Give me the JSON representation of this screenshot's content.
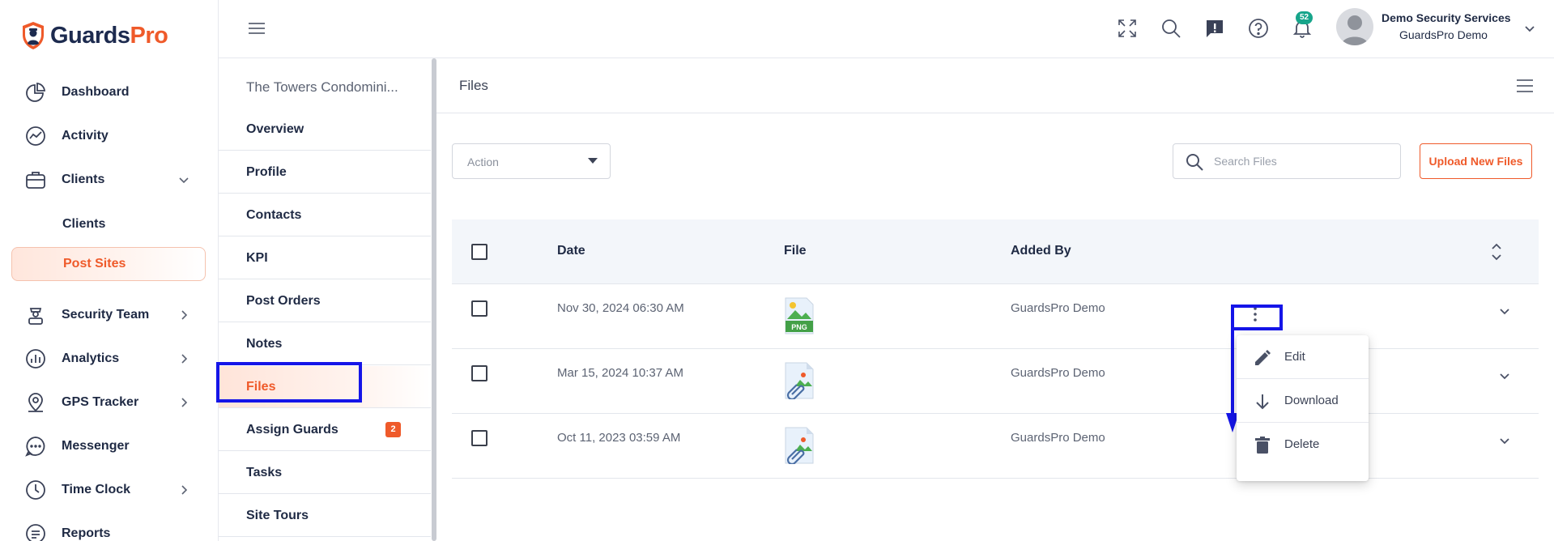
{
  "brand": {
    "name_part1": "Guards",
    "name_part2": "Pro",
    "color_primary": "#1d2b4f",
    "color_accent": "#ef5a2a"
  },
  "sidebar": {
    "items": [
      {
        "label": "Dashboard",
        "icon": "dashboard-icon"
      },
      {
        "label": "Activity",
        "icon": "activity-icon"
      },
      {
        "label": "Clients",
        "icon": "briefcase-icon",
        "expanded": true
      },
      {
        "label": "Clients",
        "sub": true
      },
      {
        "label": "Post Sites",
        "sub": true,
        "active": true
      },
      {
        "label": "Security Team",
        "icon": "guard-icon"
      },
      {
        "label": "Analytics",
        "icon": "analytics-icon"
      },
      {
        "label": "GPS Tracker",
        "icon": "location-icon"
      },
      {
        "label": "Messenger",
        "icon": "chat-icon"
      },
      {
        "label": "Time Clock",
        "icon": "clock-icon"
      },
      {
        "label": "Reports",
        "icon": "reports-icon"
      }
    ]
  },
  "topbar": {
    "notification_count": "52",
    "user_name": "Demo Security Services",
    "user_org": "GuardsPro Demo",
    "icons": [
      "fullscreen-icon",
      "search-icon",
      "feedback-icon",
      "help-icon",
      "bell-icon"
    ]
  },
  "site_menu": {
    "title": "The Towers Condomini...",
    "items": [
      {
        "label": "Overview"
      },
      {
        "label": "Profile"
      },
      {
        "label": "Contacts"
      },
      {
        "label": "KPI"
      },
      {
        "label": "Post Orders"
      },
      {
        "label": "Notes"
      },
      {
        "label": "Files",
        "active": true
      },
      {
        "label": "Assign Guards",
        "count": "2"
      },
      {
        "label": "Tasks"
      },
      {
        "label": "Site Tours"
      }
    ]
  },
  "files": {
    "title": "Files",
    "action_placeholder": "Action",
    "search_placeholder": "Search Files",
    "upload_label": "Upload New Files",
    "columns": {
      "date": "Date",
      "file": "File",
      "added_by": "Added By"
    },
    "rows": [
      {
        "date": "Nov 30, 2024 06:30 AM",
        "file_type": "png-file-icon",
        "file_badge": "PNG",
        "added_by": "GuardsPro Demo"
      },
      {
        "date": "Mar 15, 2024 10:37 AM",
        "file_type": "attachment-image-icon",
        "added_by": "GuardsPro Demo"
      },
      {
        "date": "Oct 11, 2023 03:59 AM",
        "file_type": "attachment-image-icon",
        "added_by": "GuardsPro Demo"
      }
    ],
    "row_menu": [
      {
        "label": "Edit",
        "icon": "pencil-icon"
      },
      {
        "label": "Download",
        "icon": "download-icon"
      },
      {
        "label": "Delete",
        "icon": "trash-icon"
      }
    ]
  }
}
